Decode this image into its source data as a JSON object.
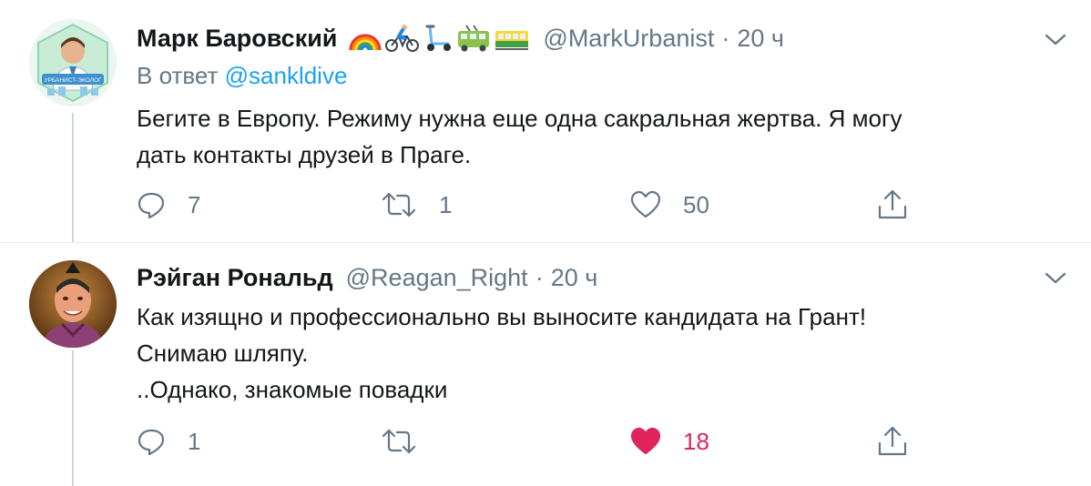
{
  "tweets": [
    {
      "display_name": "Марк Баровский",
      "name_emojis": [
        "rainbow-emoji",
        "cyclist-emoji",
        "kick-scooter-emoji",
        "trolleybus-emoji",
        "tram-car-emoji"
      ],
      "handle": "@MarkUrbanist",
      "separator": "·",
      "time": "20 ч",
      "reply_prefix": "В ответ",
      "reply_mention": "@sankldive",
      "avatar_text": "УРБАНИСТ-ЭКОЛОГ",
      "body_lines": [
        "Бегите в Европу. Режиму нужна еще одна сакральная жертва. Я могу",
        "дать контакты друзей в Праге."
      ],
      "reply_count": "7",
      "retweet_count": "1",
      "like_count": "50",
      "liked": false
    },
    {
      "display_name": "Рэйган Рональд",
      "handle": "@Reagan_Right",
      "separator": "·",
      "time": "20 ч",
      "body_lines": [
        "Как изящно и профессионально вы выносите кандидата на Грант!",
        "Снимаю шляпу.",
        "..Однако, знакомые повадки"
      ],
      "reply_count": "1",
      "retweet_count": "",
      "like_count": "18",
      "liked": true
    }
  ],
  "colors": {
    "text_primary": "#14171a",
    "text_secondary": "#657786",
    "link": "#1da1f2",
    "like_active": "#e0245e",
    "divider": "#e6ecf0"
  }
}
